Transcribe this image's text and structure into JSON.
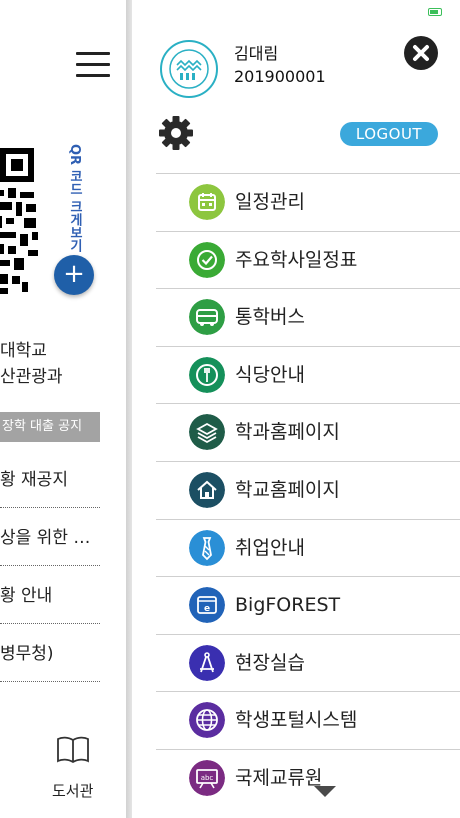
{
  "background_page": {
    "qr_label": "QR 코드 크게보기",
    "plus_label": "+",
    "school_line1": "대학교",
    "school_line2": "산관광과",
    "notice_header": "장학 대출 공지",
    "notices": [
      {
        "text": "황 재공지"
      },
      {
        "text": "상을 위한 …"
      },
      {
        "text": "황 안내"
      },
      {
        "text": "병무청)"
      }
    ],
    "library_label": "도서관"
  },
  "drawer": {
    "user": {
      "name": "김대림",
      "id": "201900001"
    },
    "logout_label": "LOGOUT",
    "menu": [
      {
        "label": "일정관리",
        "icon": "calendar-icon",
        "color": "#8dc63f"
      },
      {
        "label": "주요학사일정표",
        "icon": "check-circle-icon",
        "color": "#3aaa35"
      },
      {
        "label": "통학버스",
        "icon": "bus-icon",
        "color": "#2e9e44"
      },
      {
        "label": "식당안내",
        "icon": "restaurant-icon",
        "color": "#15905a"
      },
      {
        "label": "학과홈페이지",
        "icon": "layers-icon",
        "color": "#1f5c48"
      },
      {
        "label": "학교홈페이지",
        "icon": "home-icon",
        "color": "#1c4f63"
      },
      {
        "label": "취업안내",
        "icon": "necktie-icon",
        "color": "#2a8fd6"
      },
      {
        "label": "BigFOREST",
        "icon": "browser-e-icon",
        "color": "#2163b8"
      },
      {
        "label": "현장실습",
        "icon": "compass-icon",
        "color": "#3a2fb0"
      },
      {
        "label": "학생포털시스템",
        "icon": "globe-icon",
        "color": "#5b2da0"
      },
      {
        "label": "국제교류원",
        "icon": "abc-board-icon",
        "color": "#7b2b82"
      }
    ]
  },
  "colors": {
    "accent": "#3ba8dc",
    "notice_bar": "#a3a3a3",
    "fab": "#1f5fa8"
  }
}
